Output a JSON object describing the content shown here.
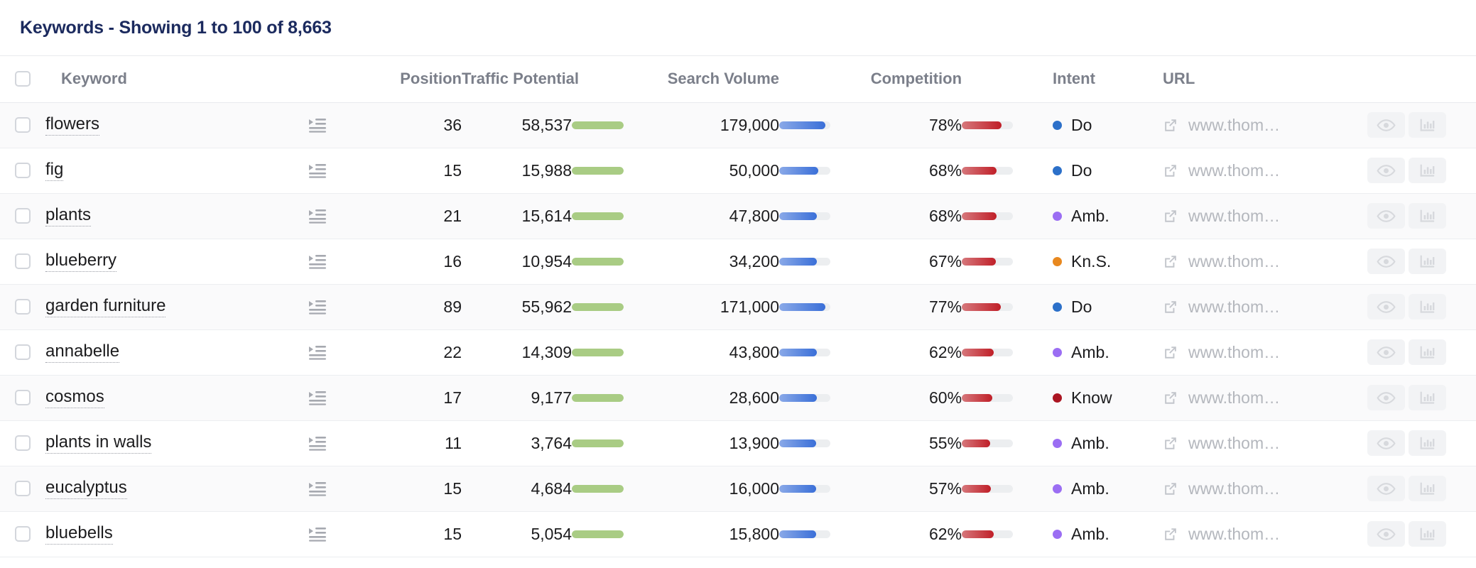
{
  "header": {
    "title": "Keywords - Showing 1 to 100 of 8,663"
  },
  "columns": {
    "keyword": "Keyword",
    "position": "Position",
    "traffic_potential": "Traffic Potential",
    "search_volume": "Search Volume",
    "competition": "Competition",
    "intent": "Intent",
    "url": "URL"
  },
  "icons": {
    "indent": "indent-list-icon",
    "external_link": "external-link-icon",
    "preview": "eye-icon",
    "metrics": "bar-chart-icon",
    "select_all": "select-all-checkbox"
  },
  "colors": {
    "title": "#1b2a5e",
    "header_text": "#7b7f8a",
    "traffic_bar": "#a9cc84",
    "volume_bar": "#3a6fd8",
    "competition_bar": "#c01f28",
    "intent_do": "#2c70c9",
    "intent_ambiguous": "#9b6ef3",
    "intent_know_simple": "#e8881f",
    "intent_know": "#ab1522",
    "row_alt": "#fafafb"
  },
  "intent_legend": {
    "Do": "#2c70c9",
    "Amb.": "#9b6ef3",
    "Kn.S.": "#e8881f",
    "Know": "#ab1522"
  },
  "chart_data": {
    "type": "table",
    "title": "Keywords - Showing 1 to 100 of 8,663",
    "columns": [
      "Keyword",
      "Position",
      "Traffic Potential",
      "Search Volume",
      "Competition",
      "Intent",
      "URL"
    ],
    "total_results": 8663,
    "showing_from": 1,
    "showing_to": 100,
    "rows": [
      {
        "keyword": "flowers",
        "position": "36",
        "traffic_potential": "58,537",
        "traffic_potential_value": 58537,
        "traffic_bar_pct": 100,
        "search_volume": "179,000",
        "search_volume_value": 179000,
        "volume_bar_pct": 90,
        "competition": "78%",
        "competition_value": 78,
        "competition_bar_pct": 78,
        "intent": "Do",
        "intent_color": "#2c70c9",
        "url": "www.thom…"
      },
      {
        "keyword": "fig",
        "position": "15",
        "traffic_potential": "15,988",
        "traffic_potential_value": 15988,
        "traffic_bar_pct": 100,
        "search_volume": "50,000",
        "search_volume_value": 50000,
        "volume_bar_pct": 76,
        "competition": "68%",
        "competition_value": 68,
        "competition_bar_pct": 68,
        "intent": "Do",
        "intent_color": "#2c70c9",
        "url": "www.thom…"
      },
      {
        "keyword": "plants",
        "position": "21",
        "traffic_potential": "15,614",
        "traffic_potential_value": 15614,
        "traffic_bar_pct": 100,
        "search_volume": "47,800",
        "search_volume_value": 47800,
        "volume_bar_pct": 74,
        "competition": "68%",
        "competition_value": 68,
        "competition_bar_pct": 68,
        "intent": "Amb.",
        "intent_color": "#9b6ef3",
        "url": "www.thom…"
      },
      {
        "keyword": "blueberry",
        "position": "16",
        "traffic_potential": "10,954",
        "traffic_potential_value": 10954,
        "traffic_bar_pct": 100,
        "search_volume": "34,200",
        "search_volume_value": 34200,
        "volume_bar_pct": 73,
        "competition": "67%",
        "competition_value": 67,
        "competition_bar_pct": 67,
        "intent": "Kn.S.",
        "intent_color": "#e8881f",
        "url": "www.thom…"
      },
      {
        "keyword": "garden furniture",
        "position": "89",
        "traffic_potential": "55,962",
        "traffic_potential_value": 55962,
        "traffic_bar_pct": 100,
        "search_volume": "171,000",
        "search_volume_value": 171000,
        "volume_bar_pct": 90,
        "competition": "77%",
        "competition_value": 77,
        "competition_bar_pct": 77,
        "intent": "Do",
        "intent_color": "#2c70c9",
        "url": "www.thom…"
      },
      {
        "keyword": "annabelle",
        "position": "22",
        "traffic_potential": "14,309",
        "traffic_potential_value": 14309,
        "traffic_bar_pct": 100,
        "search_volume": "43,800",
        "search_volume_value": 43800,
        "volume_bar_pct": 74,
        "competition": "62%",
        "competition_value": 62,
        "competition_bar_pct": 62,
        "intent": "Amb.",
        "intent_color": "#9b6ef3",
        "url": "www.thom…"
      },
      {
        "keyword": "cosmos",
        "position": "17",
        "traffic_potential": "9,177",
        "traffic_potential_value": 9177,
        "traffic_bar_pct": 100,
        "search_volume": "28,600",
        "search_volume_value": 28600,
        "volume_bar_pct": 74,
        "competition": "60%",
        "competition_value": 60,
        "competition_bar_pct": 60,
        "intent": "Know",
        "intent_color": "#ab1522",
        "url": "www.thom…"
      },
      {
        "keyword": "plants in walls",
        "position": "11",
        "traffic_potential": "3,764",
        "traffic_potential_value": 3764,
        "traffic_bar_pct": 100,
        "search_volume": "13,900",
        "search_volume_value": 13900,
        "volume_bar_pct": 72,
        "competition": "55%",
        "competition_value": 55,
        "competition_bar_pct": 55,
        "intent": "Amb.",
        "intent_color": "#9b6ef3",
        "url": "www.thom…"
      },
      {
        "keyword": "eucalyptus",
        "position": "15",
        "traffic_potential": "4,684",
        "traffic_potential_value": 4684,
        "traffic_bar_pct": 100,
        "search_volume": "16,000",
        "search_volume_value": 16000,
        "volume_bar_pct": 72,
        "competition": "57%",
        "competition_value": 57,
        "competition_bar_pct": 57,
        "intent": "Amb.",
        "intent_color": "#9b6ef3",
        "url": "www.thom…"
      },
      {
        "keyword": "bluebells",
        "position": "15",
        "traffic_potential": "5,054",
        "traffic_potential_value": 5054,
        "traffic_bar_pct": 100,
        "search_volume": "15,800",
        "search_volume_value": 15800,
        "volume_bar_pct": 72,
        "competition": "62%",
        "competition_value": 62,
        "competition_bar_pct": 62,
        "intent": "Amb.",
        "intent_color": "#9b6ef3",
        "url": "www.thom…"
      }
    ]
  }
}
